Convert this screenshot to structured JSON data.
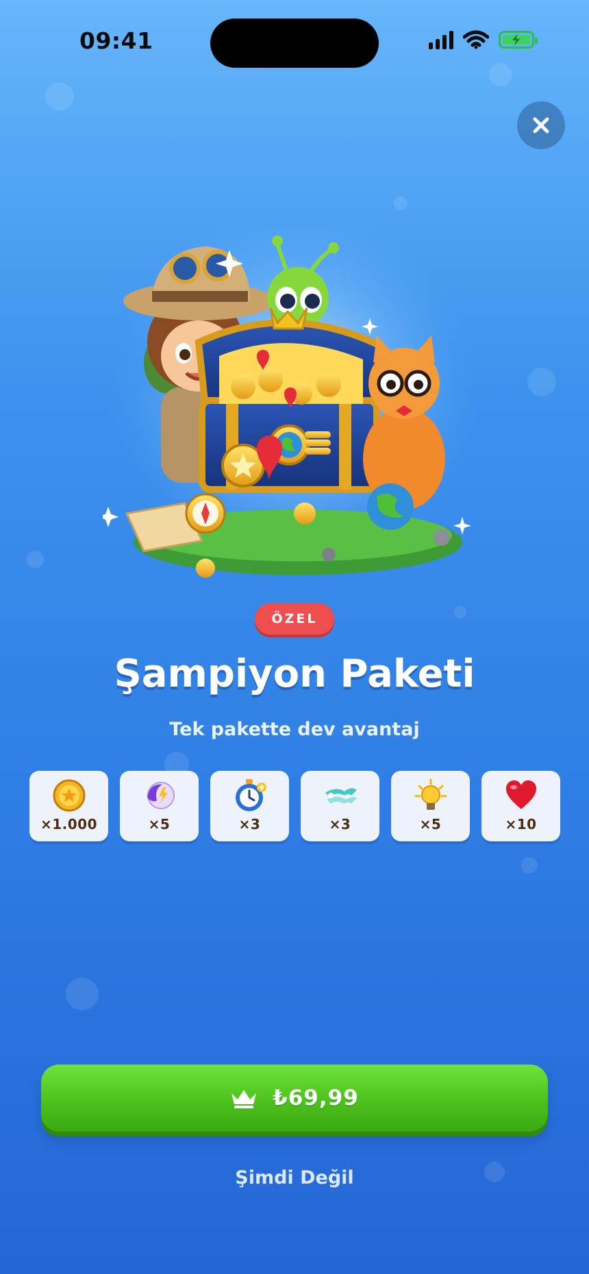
{
  "status_bar": {
    "time": "09:41",
    "signal_icon": "signal-icon",
    "wifi_icon": "wifi-icon",
    "battery_icon": "battery-charging-icon"
  },
  "close": {
    "icon": "close-icon"
  },
  "hero": {
    "description_icon": "treasure-chest-illustration"
  },
  "badge": {
    "label": "ÖZEL"
  },
  "offer": {
    "title": "Şampiyon Paketi",
    "subtitle": "Tek pakette dev avantaj"
  },
  "items": [
    {
      "icon": "coin-icon",
      "qty": "×1.000"
    },
    {
      "icon": "hint-orb-icon",
      "qty": "×5"
    },
    {
      "icon": "stopwatch-icon",
      "qty": "×3"
    },
    {
      "icon": "wind-swirl-icon",
      "qty": "×3"
    },
    {
      "icon": "lightbulb-icon",
      "qty": "×5"
    },
    {
      "icon": "heart-icon",
      "qty": "×10"
    }
  ],
  "buy_button": {
    "icon": "crown-icon",
    "price": "₺69,99"
  },
  "dismiss": {
    "label": "Şimdi Değil"
  },
  "colors": {
    "accent_green": "#4cc21c",
    "badge_red": "#ef4e4e",
    "background_top": "#66b6fb",
    "background_bottom": "#2566d6"
  }
}
